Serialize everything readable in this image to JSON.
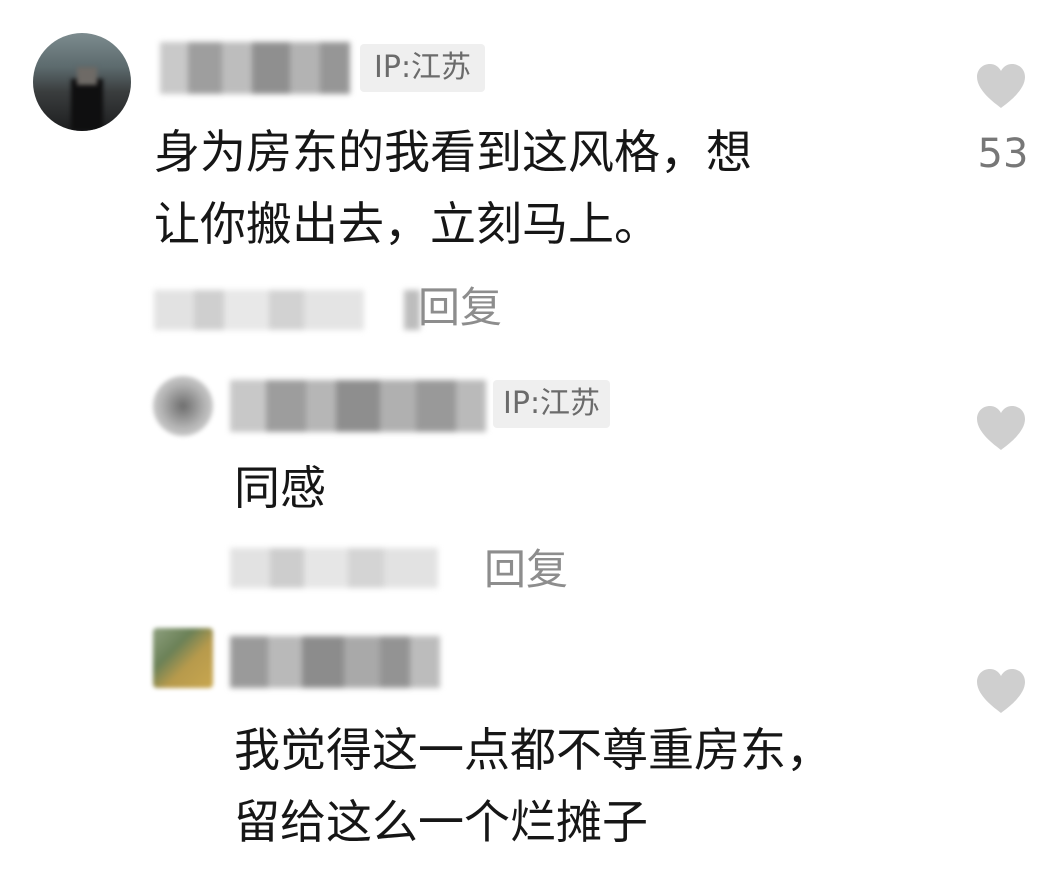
{
  "comments": [
    {
      "ip_label": "IP:江苏",
      "text": "身为房东的我看到这风格，想\n让你搬出去，立刻马上。",
      "reply_label": "回复",
      "like_count": "53",
      "like_icon": "heart-icon"
    },
    {
      "ip_label": "IP:江苏",
      "text": "同感",
      "reply_label": "回复",
      "like_icon": "heart-icon"
    },
    {
      "text": "我觉得这一点都不尊重房东，\n留给这么一个烂摊子",
      "like_icon": "heart-icon"
    }
  ],
  "colors": {
    "text": "#161616",
    "secondary": "#8d8d8d",
    "badge_bg": "#efefef",
    "heart": "#cfcfcf"
  }
}
